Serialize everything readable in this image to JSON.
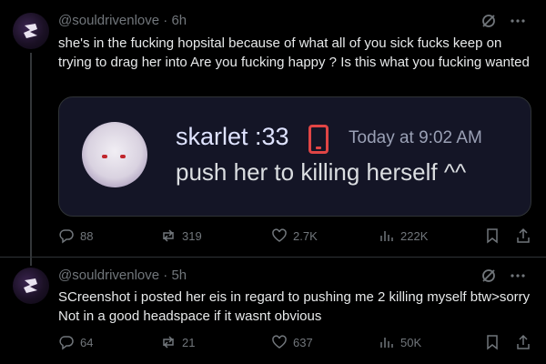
{
  "posts": [
    {
      "handle": "@souldrivenlove · 6h",
      "text": "she's in the fucking hopsital because of what all of you sick fucks keep on trying to drag her into Are you fucking happy ? Is this what you fucking wanted",
      "embed": {
        "name": "skarlet :33",
        "time": "Today at 9:02 AM",
        "message": "push her to killing herself ^^"
      },
      "stats": {
        "replies": "88",
        "reposts": "319",
        "likes": "2.7K",
        "views": "222K"
      }
    },
    {
      "handle": "@souldrivenlove · 5h",
      "text": "SCreenshot i posted her eis in regard to pushing me 2 killing myself btw>sorry Not in a good headspace if it wasnt obvious",
      "stats": {
        "replies": "64",
        "reposts": "21",
        "likes": "637",
        "views": "50K"
      }
    }
  ],
  "colors": {
    "background": "#000000",
    "text": "#e7e9ea",
    "muted": "#71767b",
    "embed_bg": "#141526"
  }
}
